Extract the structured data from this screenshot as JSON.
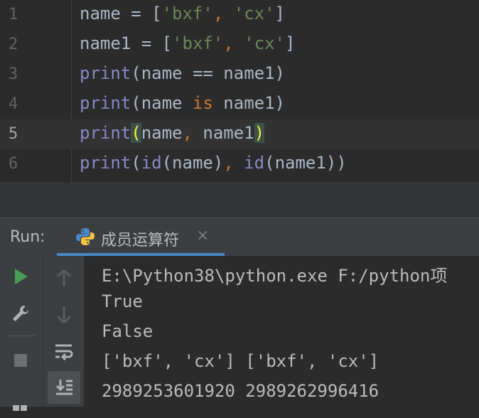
{
  "editor": {
    "lines": [
      {
        "num": "1",
        "parts": [
          {
            "t": "name = [",
            "c": "plain"
          },
          {
            "t": "'bxf'",
            "c": "str"
          },
          {
            "t": ", ",
            "c": "op"
          },
          {
            "t": "'cx'",
            "c": "str"
          },
          {
            "t": "]",
            "c": "plain"
          }
        ]
      },
      {
        "num": "2",
        "parts": [
          {
            "t": "name1 = [",
            "c": "plain"
          },
          {
            "t": "'bxf'",
            "c": "str"
          },
          {
            "t": ", ",
            "c": "op"
          },
          {
            "t": "'cx'",
            "c": "str"
          },
          {
            "t": "]",
            "c": "plain"
          }
        ]
      },
      {
        "num": "3",
        "parts": [
          {
            "t": "print",
            "c": "fn"
          },
          {
            "t": "(name == name1)",
            "c": "plain"
          }
        ]
      },
      {
        "num": "4",
        "parts": [
          {
            "t": "print",
            "c": "fn"
          },
          {
            "t": "(name ",
            "c": "plain"
          },
          {
            "t": "is",
            "c": "op"
          },
          {
            "t": " name1)",
            "c": "plain"
          }
        ]
      },
      {
        "num": "5",
        "parts": [
          {
            "t": "print",
            "c": "fn"
          },
          {
            "t": "(",
            "c": "brace"
          },
          {
            "t": "name",
            "c": "plain"
          },
          {
            "t": ", ",
            "c": "op"
          },
          {
            "t": "name1",
            "c": "plain"
          },
          {
            "t": ")",
            "c": "brace"
          }
        ]
      },
      {
        "num": "6",
        "parts": [
          {
            "t": "print",
            "c": "fn"
          },
          {
            "t": "(",
            "c": "plain"
          },
          {
            "t": "id",
            "c": "fn"
          },
          {
            "t": "(name)",
            "c": "plain"
          },
          {
            "t": ", ",
            "c": "op"
          },
          {
            "t": "id",
            "c": "fn"
          },
          {
            "t": "(name1))",
            "c": "plain"
          }
        ]
      }
    ],
    "current_line": 5
  },
  "run_panel": {
    "label": "Run:",
    "tab_label": "成员运算符",
    "close_glyph": "×"
  },
  "console": {
    "lines": [
      "E:\\Python38\\python.exe F:/python项",
      "True",
      "False",
      "['bxf', 'cx'] ['bxf', 'cx']",
      "2989253601920 2989262996416"
    ]
  },
  "colors": {
    "play": "#499c54",
    "accent": "#4a88c7"
  }
}
